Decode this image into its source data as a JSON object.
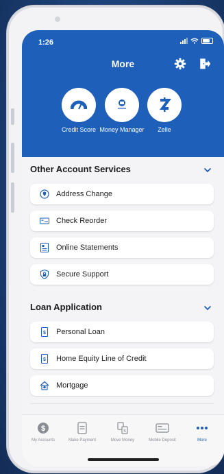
{
  "status": {
    "time": "1:26"
  },
  "header": {
    "title": "More"
  },
  "quick_actions": [
    {
      "label": "Credit Score",
      "icon": "gauge-icon"
    },
    {
      "label": "Money Manager",
      "icon": "money-manager-icon"
    },
    {
      "label": "Zelle",
      "icon": "zelle-icon"
    }
  ],
  "sections": [
    {
      "title": "Other Account Services",
      "items": [
        {
          "label": "Address Change",
          "icon": "location-pin-icon"
        },
        {
          "label": "Check Reorder",
          "icon": "check-icon"
        },
        {
          "label": "Online Statements",
          "icon": "statement-icon"
        },
        {
          "label": "Secure Support",
          "icon": "lock-icon"
        }
      ]
    },
    {
      "title": "Loan Application",
      "items": [
        {
          "label": "Personal Loan",
          "icon": "document-icon"
        },
        {
          "label": "Home Equity Line of Credit",
          "icon": "document-icon"
        },
        {
          "label": "Mortgage",
          "icon": "house-icon"
        }
      ]
    }
  ],
  "tabs": [
    {
      "label": "My Accounts",
      "icon": "dollar-icon"
    },
    {
      "label": "Make Payment",
      "icon": "payment-icon"
    },
    {
      "label": "Move Money",
      "icon": "transfer-icon"
    },
    {
      "label": "Mobile Deposit",
      "icon": "deposit-icon"
    },
    {
      "label": "More",
      "icon": "more-dots-icon",
      "active": true
    }
  ],
  "colors": {
    "brand_blue": "#1e5fba",
    "background": "#f4f4f6"
  }
}
